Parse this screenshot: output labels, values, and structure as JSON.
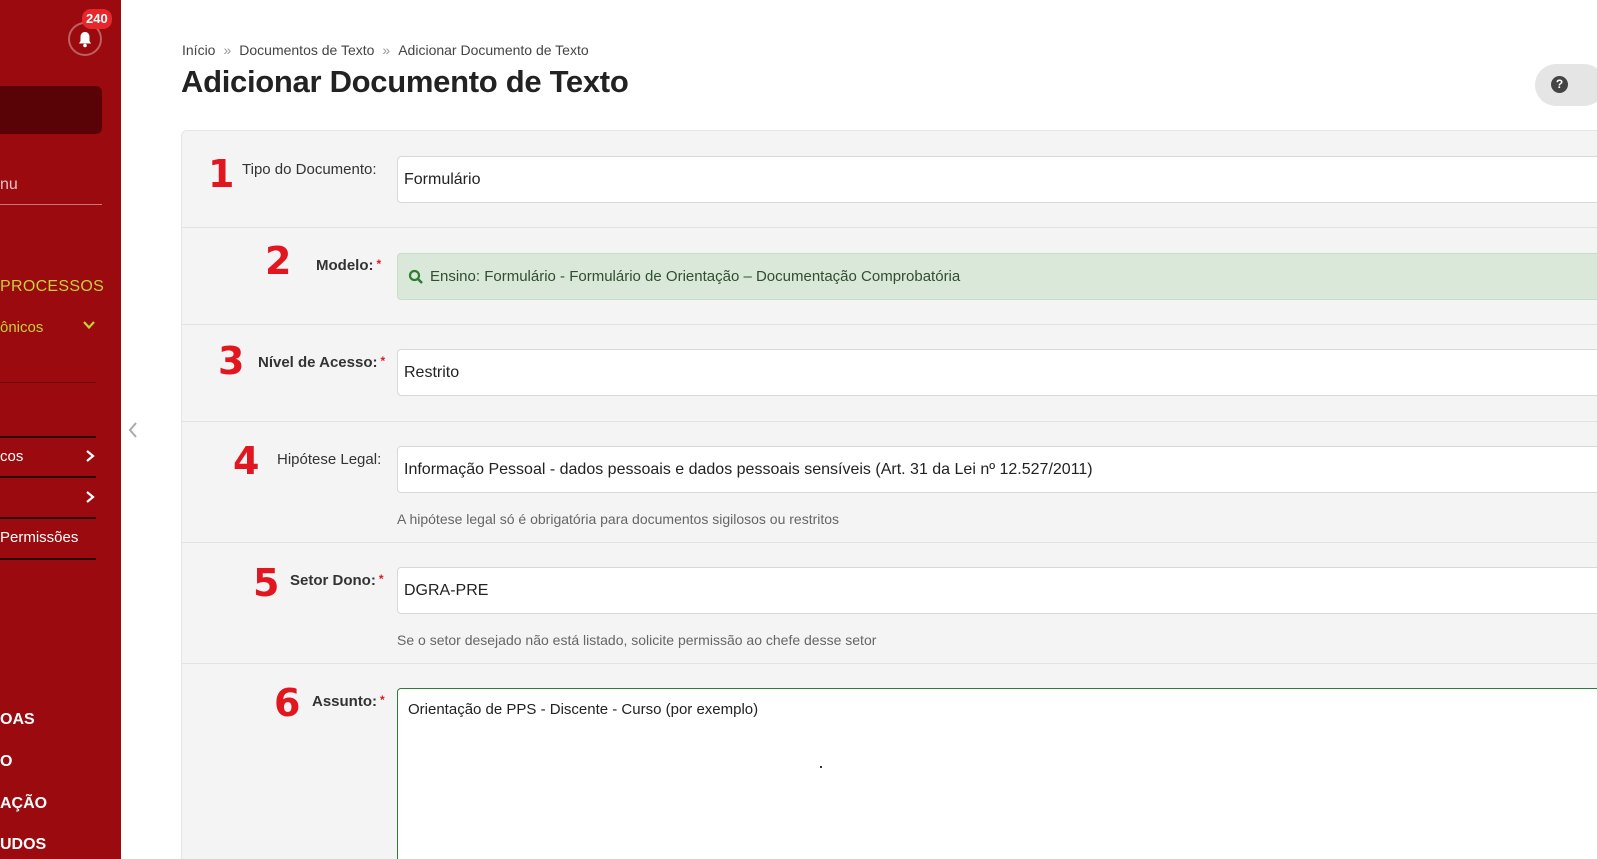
{
  "notifications": {
    "count": "240"
  },
  "sidebar": {
    "menu_search_fragment": "nu",
    "processos_label": "PROCESSOS",
    "eletronicos_label": "ônicos",
    "items": [
      {
        "label": "cos"
      },
      {
        "label": ""
      },
      {
        "label": "Permissões"
      }
    ],
    "caps": [
      "OAS",
      "O",
      "AÇÃO",
      "UDOS"
    ]
  },
  "breadcrumb": {
    "items": [
      "Início",
      "Documentos de Texto",
      "Adicionar Documento de Texto"
    ],
    "separator": "»"
  },
  "page": {
    "title": "Adicionar Documento de Texto"
  },
  "form": {
    "tipo": {
      "step": "1",
      "label": "Tipo do Documento:",
      "value": "Formulário"
    },
    "modelo": {
      "step": "2",
      "label": "Modelo:",
      "required": "*",
      "value": "Ensino: Formulário - Formulário de Orientação – Documentação Comprobatória"
    },
    "nivel": {
      "step": "3",
      "label": "Nível de Acesso:",
      "required": "*",
      "value": "Restrito"
    },
    "hipotese": {
      "step": "4",
      "label": "Hipótese Legal:",
      "value": "Informação Pessoal - dados pessoais e dados pessoais sensíveis (Art. 31 da Lei nº 12.527/2011)",
      "help": "A hipótese legal só é obrigatória para documentos sigilosos ou restritos"
    },
    "setor": {
      "step": "5",
      "label": "Setor Dono:",
      "required": "*",
      "value": "DGRA-PRE",
      "help": "Se o setor desejado não está listado, solicite permissão ao chefe desse setor"
    },
    "assunto": {
      "step": "6",
      "label": "Assunto:",
      "required": "*",
      "value": "Orientação de PPS - Discente - Curso (por exemplo)"
    }
  },
  "colors": {
    "sidebar": "#9b0a0e",
    "accent_red": "#e2161e",
    "lime": "#c3d13a",
    "model_bg": "#d9e8d8"
  }
}
